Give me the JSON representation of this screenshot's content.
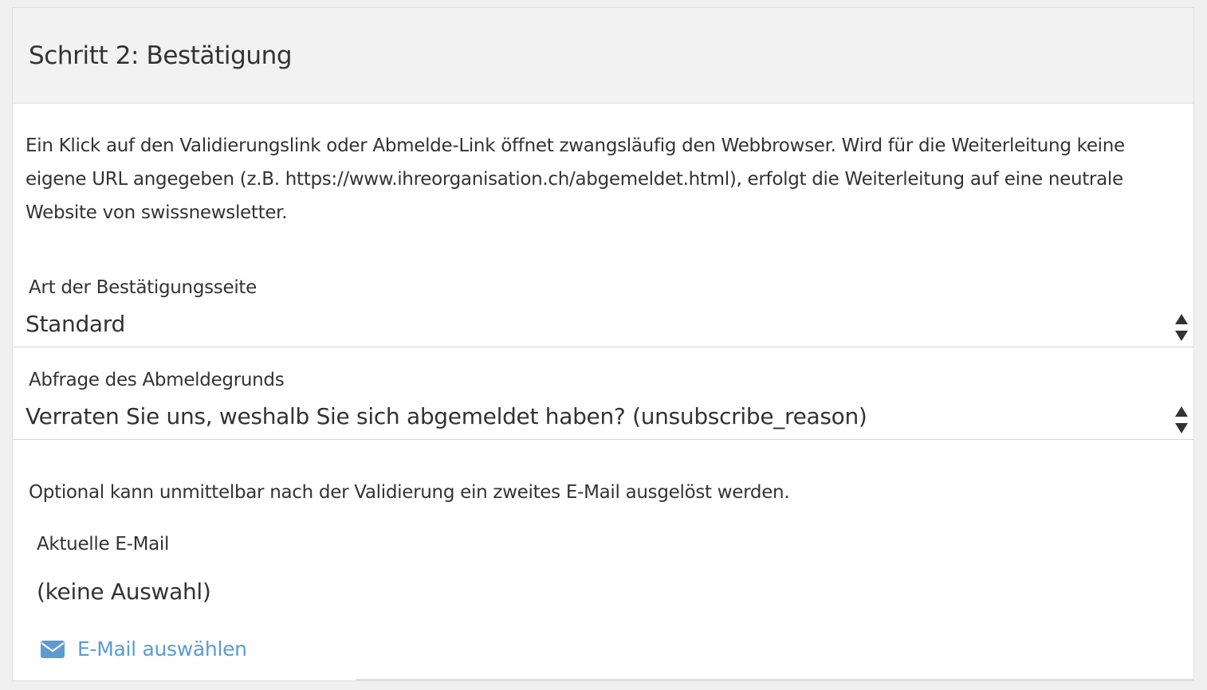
{
  "panel": {
    "title": "Schritt 2: Bestätigung",
    "intro_text": "Ein Klick auf den Validierungslink oder Abmelde-Link öffnet zwangsläufig den Webbrowser. Wird für die Weiterleitung keine eigene URL angegeben (z.B. https://www.ihreorganisation.ch/abgemeldet.html), erfolgt die Weiterleitung auf eine neutrale Website von swissnewsletter."
  },
  "fields": {
    "confirmation_page": {
      "label": "Art der Bestätigungsseite",
      "value": "Standard"
    },
    "unsubscribe_reason": {
      "label": "Abfrage des Abmeldegrunds",
      "value": "Verraten Sie uns, weshalb Sie sich abgemeldet haben? (unsubscribe_reason)"
    }
  },
  "email": {
    "optional_text": "Optional kann unmittelbar nach der Validierung ein zweites E-Mail ausgelöst werden.",
    "current_label": "Aktuelle E-Mail",
    "current_value": "(keine Auswahl)",
    "select_label": "E-Mail auswählen",
    "select_icon": "envelope-icon"
  },
  "colors": {
    "link": "#5b9bd1",
    "header_bg": "#f2f2f2",
    "text": "#333333"
  }
}
